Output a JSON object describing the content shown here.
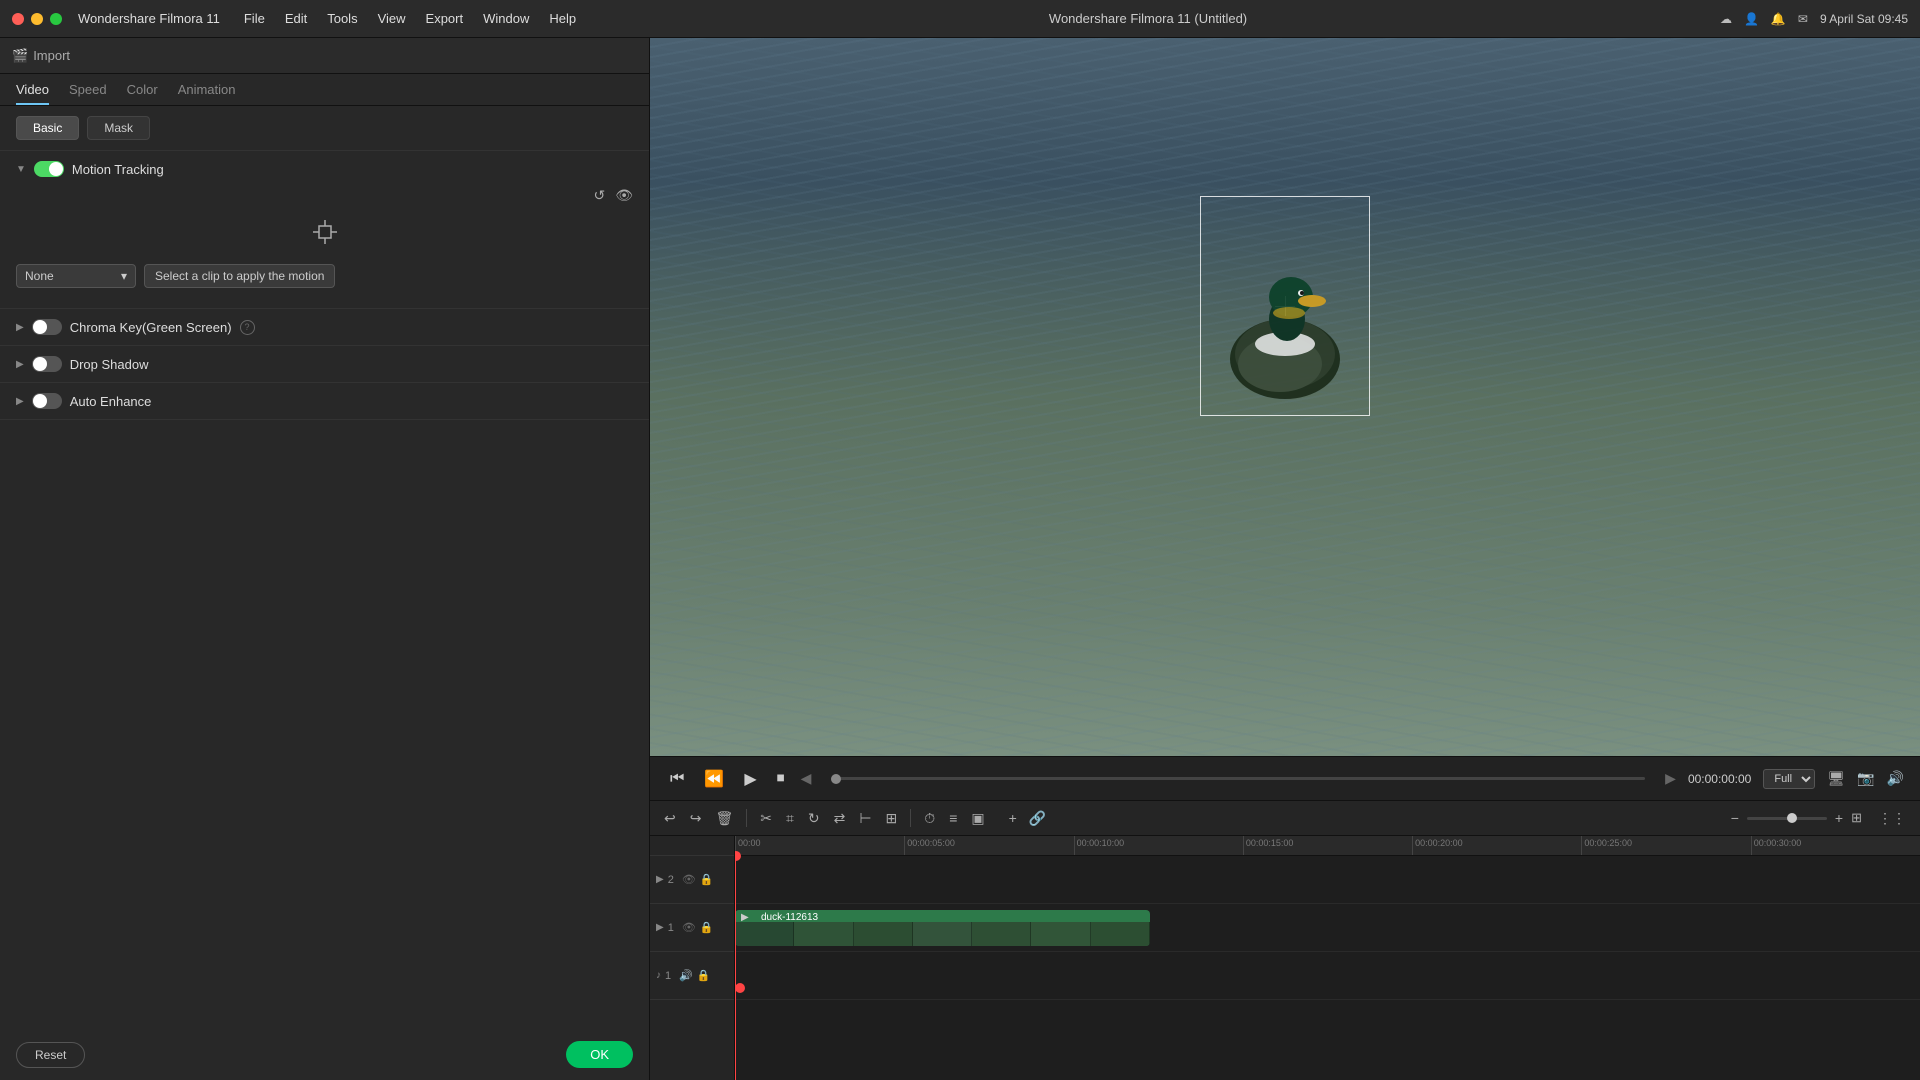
{
  "titlebar": {
    "app_name": "Wondershare Filmora 11",
    "menus": [
      "File",
      "Edit",
      "Tools",
      "View",
      "Export",
      "Window",
      "Help"
    ],
    "title": "Wondershare Filmora 11 (Untitled)",
    "date": "9 April Sat  09:45"
  },
  "import_bar": {
    "label": "Import"
  },
  "panel_tabs": [
    {
      "label": "Video",
      "active": true
    },
    {
      "label": "Speed",
      "active": false
    },
    {
      "label": "Color",
      "active": false
    },
    {
      "label": "Animation",
      "active": false
    }
  ],
  "sub_tabs": [
    {
      "label": "Basic",
      "active": true
    },
    {
      "label": "Mask",
      "active": false
    }
  ],
  "sections": {
    "motion_tracking": {
      "title": "Motion Tracking",
      "enabled": true,
      "none_label": "None",
      "apply_motion_label": "Select a clip to apply the motion"
    },
    "chroma_key": {
      "title": "Chroma Key(Green Screen)",
      "enabled": false
    },
    "drop_shadow": {
      "title": "Drop Shadow",
      "enabled": false
    },
    "auto_enhance": {
      "title": "Auto Enhance",
      "enabled": false
    }
  },
  "footer": {
    "reset_label": "Reset",
    "ok_label": "OK"
  },
  "preview": {
    "time": "00:00:00:00",
    "quality": "Full",
    "nav_prev": "◀",
    "nav_next": "▶"
  },
  "timeline": {
    "ruler_marks": [
      "00:00",
      "00:00:05:00",
      "00:00:10:00",
      "00:00:15:00",
      "00:00:20:00",
      "00:00:25:00",
      "00:00:30:00"
    ],
    "tracks": [
      {
        "id": 2,
        "type": "video"
      },
      {
        "id": 1,
        "type": "video",
        "clip": "duck-112613"
      },
      {
        "id": 1,
        "type": "audio"
      }
    ],
    "clip_name": "duck-112613"
  }
}
